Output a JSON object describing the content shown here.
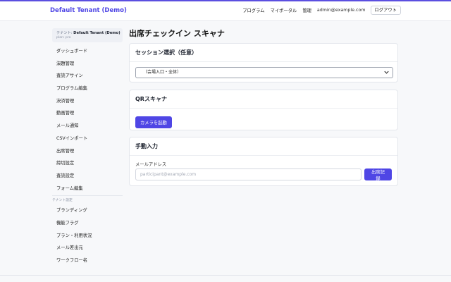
{
  "header": {
    "brand": "Default Tenant (Demo)",
    "nav": [
      "プログラム",
      "マイポータル",
      "管理"
    ],
    "email": "admin@example.com",
    "logout_label": "ログアウト"
  },
  "sidebar": {
    "tenant_prefix": "テナント: ",
    "tenant_name": "Default Tenant (Demo)",
    "plan": "plan: pro",
    "items": [
      "ダッシュボード",
      "演題管理",
      "査読アサイン",
      "プログラム編集",
      "決済管理",
      "動画管理",
      "メール通知",
      "CSVインポート",
      "出席管理",
      "締切設定",
      "査読設定",
      "フォーム編集"
    ],
    "section_label": "テナント設定",
    "settings_items": [
      "ブランディング",
      "機能フラグ",
      "プラン・利用状況",
      "メール差出元",
      "ワークフロー名"
    ]
  },
  "main": {
    "title": "出席チェックイン スキャナ",
    "session": {
      "heading": "セッション選択（任意）",
      "selected": "（会場入口・全体）"
    },
    "qr": {
      "heading": "QRスキャナ",
      "start_button": "カメラを起動"
    },
    "manual": {
      "heading": "手動入力",
      "email_label": "メールアドレス",
      "email_placeholder": "participant@example.com",
      "submit_button": "出席記録"
    }
  },
  "colors": {
    "accent": "#4f46e5"
  }
}
